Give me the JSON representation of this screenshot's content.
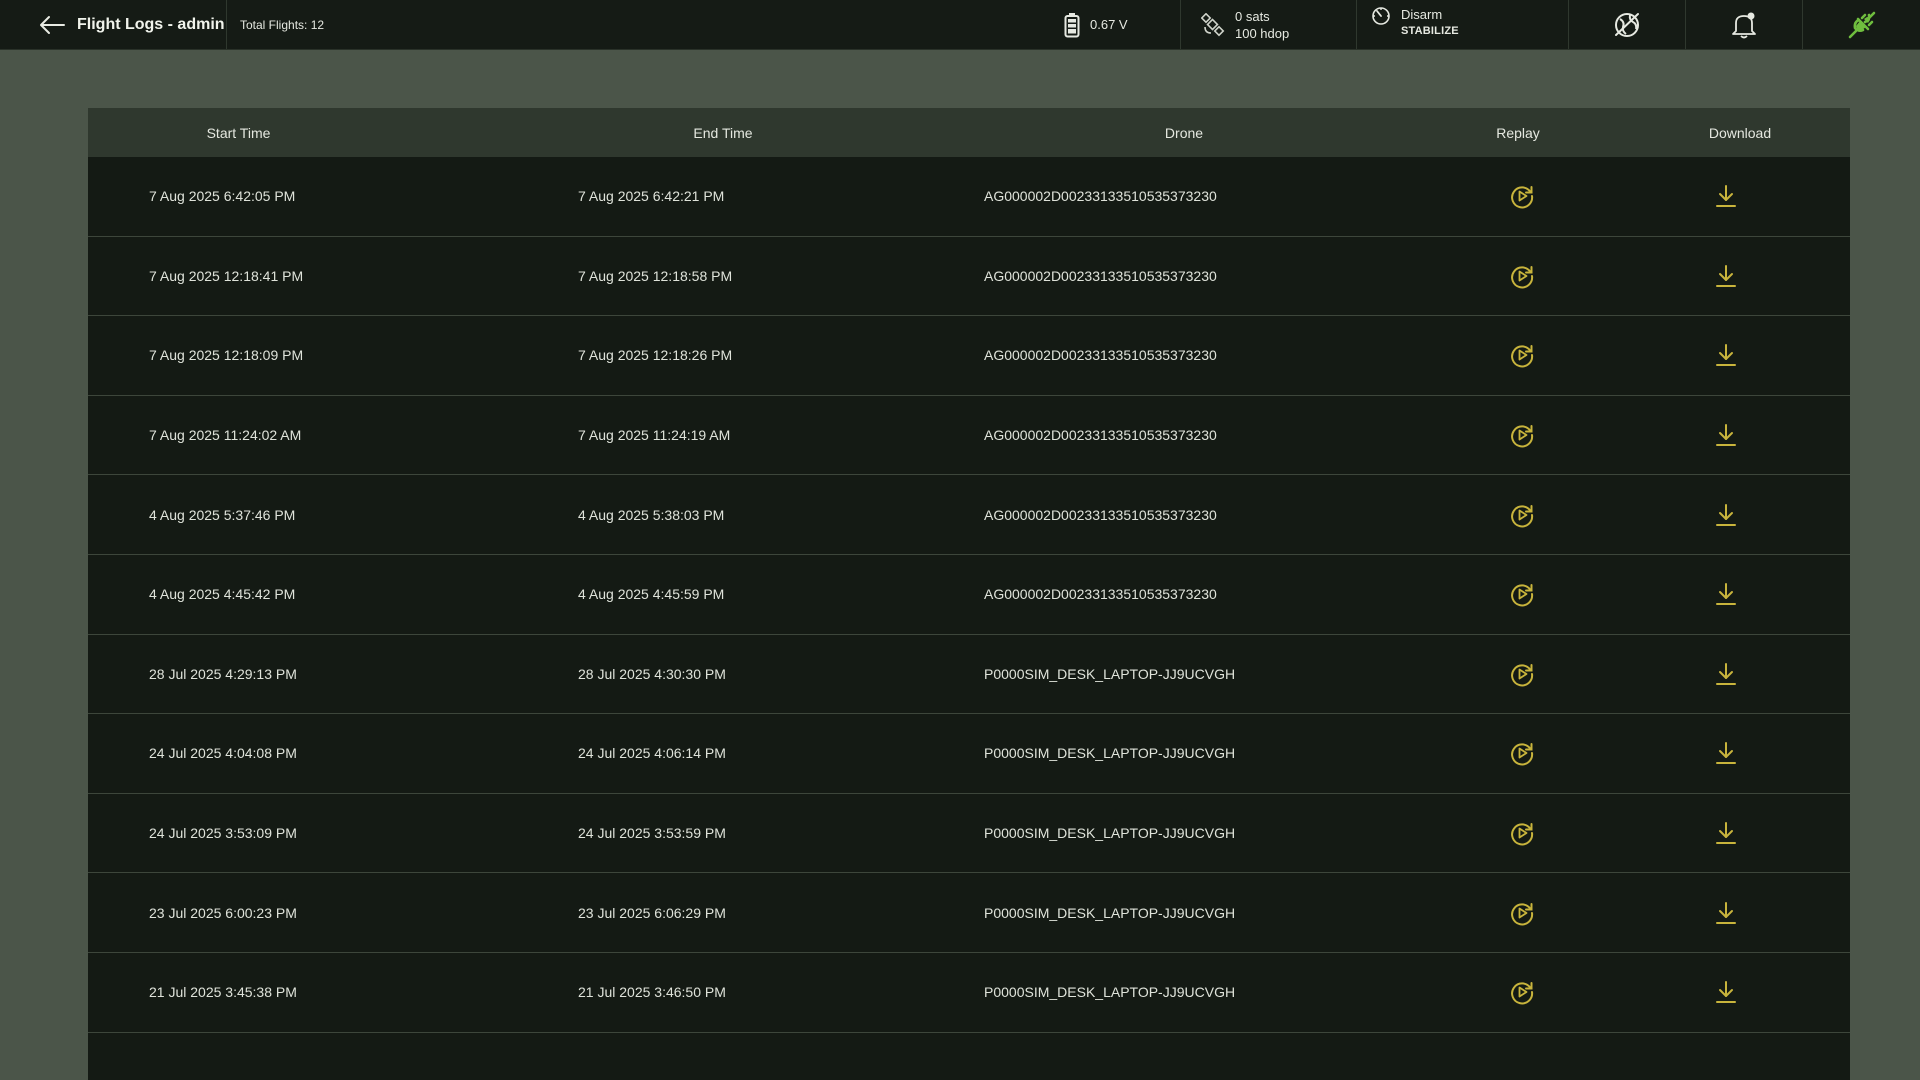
{
  "header": {
    "title": "Flight Logs - admin",
    "total_flights": "Total Flights: 12",
    "battery": "0.67 V",
    "gps_sats": "0 sats",
    "gps_hdop": "100 hdop",
    "arm_state": "Disarm",
    "flight_mode": "STABILIZE"
  },
  "table": {
    "columns": [
      "Start Time",
      "End Time",
      "Drone",
      "Replay",
      "Download"
    ],
    "rows": [
      {
        "start": "7 Aug 2025 6:42:05 PM",
        "end": "7 Aug 2025 6:42:21 PM",
        "drone": "AG000002D0023313351053537323​0"
      },
      {
        "start": "7 Aug 2025 12:18:41 PM",
        "end": "7 Aug 2025 12:18:58 PM",
        "drone": "AG000002D00233133510535373230"
      },
      {
        "start": "7 Aug 2025 12:18:09 PM",
        "end": "7 Aug 2025 12:18:26 PM",
        "drone": "AG000002D00233133510535373230"
      },
      {
        "start": "7 Aug 2025 11:24:02 AM",
        "end": "7 Aug 2025 11:24:19 AM",
        "drone": "AG000002D00233133510535373230"
      },
      {
        "start": "4 Aug 2025 5:37:46 PM",
        "end": "4 Aug 2025 5:38:03 PM",
        "drone": "AG000002D00233133510535373230"
      },
      {
        "start": "4 Aug 2025 4:45:42 PM",
        "end": "4 Aug 2025 4:45:59 PM",
        "drone": "AG000002D00233133510535373230"
      },
      {
        "start": "28 Jul 2025 4:29:13 PM",
        "end": "28 Jul 2025 4:30:30 PM",
        "drone": "P0000SIM_DESK_LAPTOP-JJ9UCVGH"
      },
      {
        "start": "24 Jul 2025 4:04:08 PM",
        "end": "24 Jul 2025 4:06:14 PM",
        "drone": "P0000SIM_DESK_LAPTOP-JJ9UCVGH"
      },
      {
        "start": "24 Jul 2025 3:53:09 PM",
        "end": "24 Jul 2025 3:53:59 PM",
        "drone": "P0000SIM_DESK_LAPTOP-JJ9UCVGH"
      },
      {
        "start": "23 Jul 2025 6:00:23 PM",
        "end": "23 Jul 2025 6:06:29 PM",
        "drone": "P0000SIM_DESK_LAPTOP-JJ9UCVGH"
      },
      {
        "start": "21 Jul 2025 3:45:38 PM",
        "end": "21 Jul 2025 3:46:50 PM",
        "drone": "P0000SIM_DESK_LAPTOP-JJ9UCVGH"
      }
    ]
  },
  "icons": {
    "back": "arrow-left-icon",
    "battery": "battery-icon",
    "gps": "satellite-icon",
    "mode": "gauge-icon",
    "map": "globe-off-icon",
    "notifications": "bell-icon",
    "connection": "plug-icon",
    "replay": "replay-icon",
    "download": "download-icon"
  },
  "colors": {
    "accent": "#c8b43c",
    "connected": "#6fbe3e",
    "background": "#4b5549",
    "table_bg": "#141a14",
    "header_bg": "#151b15"
  }
}
